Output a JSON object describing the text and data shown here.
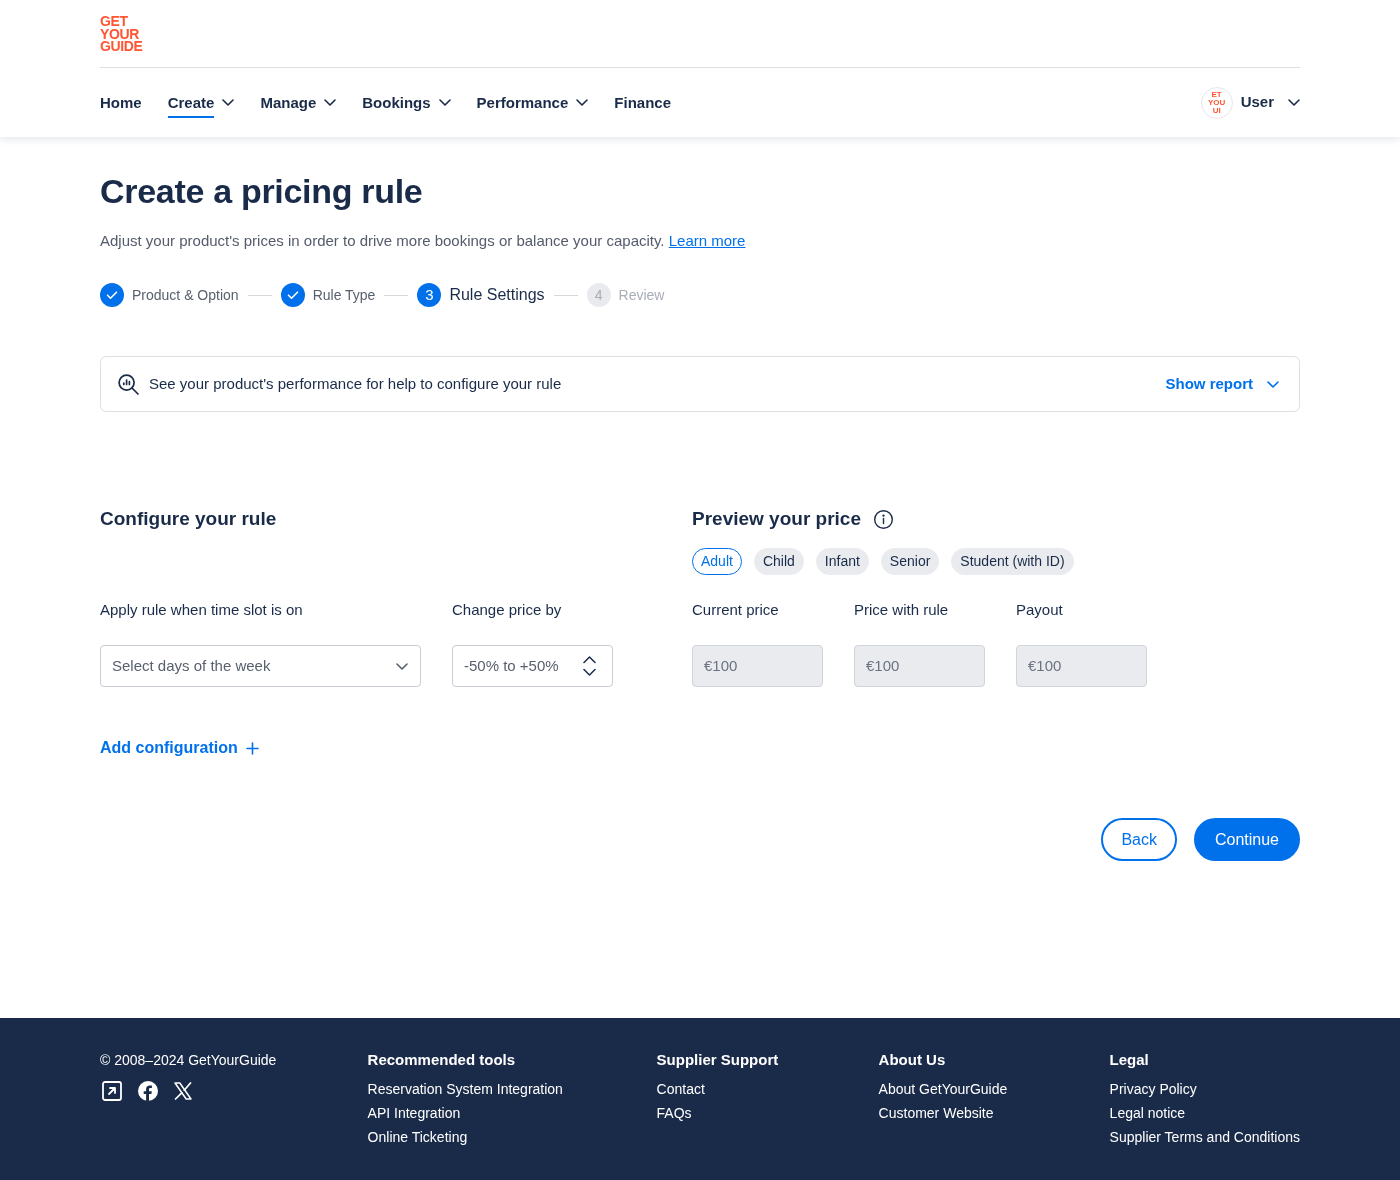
{
  "logo": {
    "lines": [
      "GET",
      "YOUR",
      "GUIDE"
    ]
  },
  "nav": {
    "items": [
      {
        "label": "Home",
        "selected": false,
        "dropdown": false
      },
      {
        "label": "Create",
        "selected": true,
        "dropdown": true
      },
      {
        "label": "Manage",
        "selected": false,
        "dropdown": true
      },
      {
        "label": "Bookings",
        "selected": false,
        "dropdown": true
      },
      {
        "label": "Performance",
        "selected": false,
        "dropdown": true
      },
      {
        "label": "Finance",
        "selected": false,
        "dropdown": false
      }
    ],
    "user": {
      "avatar_lines": [
        "ET",
        "YOU",
        "UI"
      ],
      "label": "User"
    }
  },
  "page": {
    "title": "Create a pricing rule",
    "description": "Adjust your product's prices in order to drive more bookings or balance your capacity.",
    "link": "Learn more"
  },
  "stepper": [
    {
      "label": "Product & Option",
      "done": true,
      "selected": false
    },
    {
      "label": "Rule Type",
      "done": true,
      "selected": false
    },
    {
      "label": "Rule Settings",
      "done": false,
      "selected": true,
      "number": "3"
    },
    {
      "label": "Review",
      "done": false,
      "selected": false,
      "number": "4"
    }
  ],
  "report_bar": {
    "text": "See your product's performance for help to configure your rule",
    "action": "Show report",
    "expanded": false
  },
  "configure": {
    "heading": "Configure your rule",
    "fields": [
      {
        "kind": "select",
        "label": "Apply rule when time slot is on",
        "placeholder": "Select days of the week"
      },
      {
        "kind": "number",
        "label": "Change price by",
        "placeholder": "-50% to +50%"
      }
    ],
    "add_action": "Add configuration"
  },
  "preview": {
    "heading": "Preview your price",
    "tabs": [
      {
        "label": "Adult",
        "selected": true
      },
      {
        "label": "Child",
        "selected": false
      },
      {
        "label": "Infant",
        "selected": false
      },
      {
        "label": "Senior",
        "selected": false
      },
      {
        "label": "Student (with ID)",
        "selected": false
      }
    ],
    "fields": [
      {
        "label": "Current price",
        "value": "€100",
        "disabled": true
      },
      {
        "label": "Price with rule",
        "value": "€100",
        "disabled": true
      },
      {
        "label": "Payout",
        "value": "€100",
        "disabled": true
      }
    ]
  },
  "actions": [
    {
      "label": "Back",
      "kind": "secondary"
    },
    {
      "label": "Continue",
      "kind": "primary"
    }
  ],
  "footer": {
    "copyright": "© 2008–2024 GetYourGuide",
    "columns": [
      {
        "heading": "Recommended tools",
        "links": [
          "Reservation System Integration",
          "API Integration",
          "Online Ticketing"
        ]
      },
      {
        "heading": "Supplier Support",
        "links": [
          "Contact",
          "FAQs"
        ]
      },
      {
        "heading": "About Us",
        "links": [
          "About GetYourGuide",
          "Customer Website"
        ]
      },
      {
        "heading": "Legal",
        "links": [
          "Privacy Policy",
          "Legal notice",
          "Supplier Terms and Conditions"
        ]
      }
    ]
  }
}
